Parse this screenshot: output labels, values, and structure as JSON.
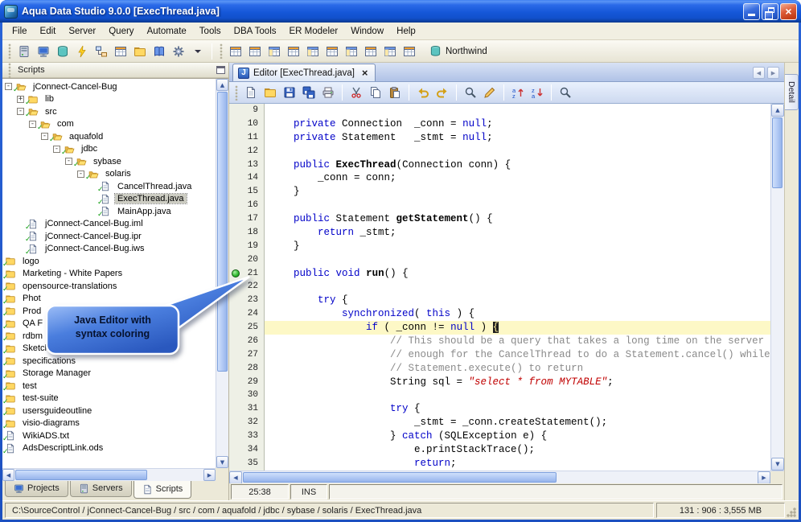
{
  "window": {
    "title": "Aqua Data Studio 9.0.0 [ExecThread.java]",
    "controls": {
      "close": "×"
    }
  },
  "glyphs": {
    "up": "▲",
    "down": "▼",
    "left": "◀",
    "right": "▶"
  },
  "menubar": {
    "items": [
      "File",
      "Edit",
      "Server",
      "Query",
      "Automate",
      "Tools",
      "DBA Tools",
      "ER Modeler",
      "Window",
      "Help"
    ]
  },
  "main_toolbar": {
    "icons": [
      {
        "name": "register-server-icon",
        "sym": "server"
      },
      {
        "name": "server-browser-icon",
        "sym": "monitor"
      },
      {
        "name": "schema-browser-icon",
        "sym": "db"
      },
      {
        "name": "query-analyzer-icon",
        "sym": "bolt"
      },
      {
        "name": "er-modeler-icon",
        "sym": "er"
      },
      {
        "name": "table-data-icon",
        "sym": "grid"
      },
      {
        "name": "open-file-icon",
        "sym": "folder"
      },
      {
        "name": "reference-book-icon",
        "sym": "book"
      },
      {
        "name": "options-icon",
        "sym": "gear"
      },
      {
        "name": "toolbar-menu-caret-icon",
        "sym": "caret"
      }
    ],
    "grid_icons": [
      {
        "name": "result-grid-icon-1",
        "sym": "grid"
      },
      {
        "name": "result-grid-icon-2",
        "sym": "grid"
      },
      {
        "name": "result-grid-icon-3",
        "sym": "grid2"
      },
      {
        "name": "result-grid-icon-4",
        "sym": "grid"
      },
      {
        "name": "result-grid-icon-5",
        "sym": "grid2"
      },
      {
        "name": "result-grid-icon-6",
        "sym": "grid"
      },
      {
        "name": "result-grid-icon-7",
        "sym": "grid2"
      },
      {
        "name": "result-grid-icon-8",
        "sym": "grid"
      },
      {
        "name": "result-grid-icon-9",
        "sym": "grid2"
      },
      {
        "name": "result-grid-icon-10",
        "sym": "grid"
      }
    ],
    "connection": {
      "name": "current-connection",
      "label": "Northwind",
      "sym": "db"
    }
  },
  "scripts_panel": {
    "title": "Scripts",
    "check_glyph": "✓",
    "tree": [
      {
        "i": 0,
        "e": "-",
        "t": "folder-open",
        "l": "jConnect-Cancel-Bug"
      },
      {
        "i": 1,
        "e": "+",
        "t": "folder",
        "l": "lib"
      },
      {
        "i": 1,
        "e": "-",
        "t": "folder-open",
        "l": "src"
      },
      {
        "i": 2,
        "e": "-",
        "t": "folder-open",
        "l": "com"
      },
      {
        "i": 3,
        "e": "-",
        "t": "folder-open",
        "l": "aquafold"
      },
      {
        "i": 4,
        "e": "-",
        "t": "folder-open",
        "l": "jdbc"
      },
      {
        "i": 5,
        "e": "-",
        "t": "folder-open",
        "l": "sybase"
      },
      {
        "i": 6,
        "e": "-",
        "t": "folder-open",
        "l": "solaris"
      },
      {
        "i": 7,
        "e": "",
        "t": "file",
        "l": "CancelThread.java"
      },
      {
        "i": 7,
        "e": "",
        "t": "file",
        "l": "ExecThread.java",
        "sel": true
      },
      {
        "i": 7,
        "e": "",
        "t": "file",
        "l": "MainApp.java"
      },
      {
        "i": 1,
        "e": "",
        "t": "file",
        "l": "jConnect-Cancel-Bug.iml"
      },
      {
        "i": 1,
        "e": "",
        "t": "file",
        "l": "jConnect-Cancel-Bug.ipr"
      },
      {
        "i": 1,
        "e": "",
        "t": "file",
        "l": "jConnect-Cancel-Bug.iws"
      },
      {
        "i": 0,
        "e": "",
        "t": "folder",
        "l": "logo"
      },
      {
        "i": 0,
        "e": "",
        "t": "folder",
        "l": "Marketing - White Papers"
      },
      {
        "i": 0,
        "e": "",
        "t": "folder",
        "l": "opensource-translations"
      },
      {
        "i": 0,
        "e": "",
        "t": "folder",
        "l": "Phot"
      },
      {
        "i": 0,
        "e": "",
        "t": "folder",
        "l": "Prod"
      },
      {
        "i": 0,
        "e": "",
        "t": "folder",
        "l": "QA F"
      },
      {
        "i": 0,
        "e": "",
        "t": "folder",
        "l": "rdbm"
      },
      {
        "i": 0,
        "e": "",
        "t": "folder",
        "l": "Sketchbooks"
      },
      {
        "i": 0,
        "e": "",
        "t": "folder",
        "l": "specifications"
      },
      {
        "i": 0,
        "e": "",
        "t": "folder",
        "l": "Storage Manager"
      },
      {
        "i": 0,
        "e": "",
        "t": "folder",
        "l": "test"
      },
      {
        "i": 0,
        "e": "",
        "t": "folder",
        "l": "test-suite"
      },
      {
        "i": 0,
        "e": "",
        "t": "folder",
        "l": "usersguideoutline"
      },
      {
        "i": 0,
        "e": "",
        "t": "folder",
        "l": "visio-diagrams"
      },
      {
        "i": 0,
        "e": "",
        "t": "file",
        "l": "WikiADS.txt"
      },
      {
        "i": 0,
        "e": "",
        "t": "file",
        "l": "AdsDescriptLink.ods"
      }
    ],
    "tabs": [
      {
        "name": "tab-projects",
        "label": "Projects",
        "sym": "monitor"
      },
      {
        "name": "tab-servers",
        "label": "Servers",
        "sym": "server"
      },
      {
        "name": "tab-scripts",
        "label": "Scripts",
        "sym": "page",
        "active": true
      }
    ]
  },
  "callout": {
    "line1": "Java Editor with",
    "line2": "syntax coloring"
  },
  "right_panel": {
    "tab": "Detail"
  },
  "editor": {
    "tab": {
      "label": "Editor [ExecThread.java]",
      "close": "×",
      "icon_glyph": "J"
    },
    "toolbar_icons": [
      {
        "name": "new-file-icon",
        "sym": "page"
      },
      {
        "name": "open-file-icon",
        "sym": "folder"
      },
      {
        "name": "save-icon",
        "sym": "floppy"
      },
      {
        "name": "save-all-icon",
        "sym": "floppy2"
      },
      {
        "name": "print-icon",
        "sym": "printer"
      },
      {
        "sep": true
      },
      {
        "name": "cut-icon",
        "sym": "scissors"
      },
      {
        "name": "copy-icon",
        "sym": "copy"
      },
      {
        "name": "paste-icon",
        "sym": "paste"
      },
      {
        "sep": true
      },
      {
        "name": "undo-icon",
        "sym": "undo"
      },
      {
        "name": "redo-icon",
        "sym": "redo"
      },
      {
        "sep": true
      },
      {
        "name": "find-icon",
        "sym": "find"
      },
      {
        "name": "replace-icon",
        "sym": "pencil"
      },
      {
        "sep": true
      },
      {
        "name": "sort-ascending-icon",
        "sym": "sortasc"
      },
      {
        "name": "sort-descending-icon",
        "sym": "sortdesc"
      },
      {
        "sep": true
      },
      {
        "name": "zoom-icon",
        "sym": "find"
      }
    ],
    "code": {
      "lines": [
        {
          "n": 9,
          "seg": []
        },
        {
          "n": 10,
          "seg": [
            [
              "p",
              "    "
            ],
            [
              "k",
              "private"
            ],
            [
              "p",
              " Connection  _conn = "
            ],
            [
              "k",
              "null"
            ],
            [
              "p",
              ";"
            ]
          ]
        },
        {
          "n": 11,
          "seg": [
            [
              "p",
              "    "
            ],
            [
              "k",
              "private"
            ],
            [
              "p",
              " Statement   _stmt = "
            ],
            [
              "k",
              "null"
            ],
            [
              "p",
              ";"
            ]
          ]
        },
        {
          "n": 12,
          "seg": []
        },
        {
          "n": 13,
          "seg": [
            [
              "p",
              "    "
            ],
            [
              "k",
              "public"
            ],
            [
              "p",
              " "
            ],
            [
              "m",
              "ExecThread"
            ],
            [
              "p",
              "(Connection conn) {"
            ]
          ]
        },
        {
          "n": 14,
          "seg": [
            [
              "p",
              "        _conn = conn;"
            ]
          ]
        },
        {
          "n": 15,
          "seg": [
            [
              "p",
              "    }"
            ]
          ]
        },
        {
          "n": 16,
          "seg": []
        },
        {
          "n": 17,
          "seg": [
            [
              "p",
              "    "
            ],
            [
              "k",
              "public"
            ],
            [
              "p",
              " Statement "
            ],
            [
              "m",
              "getStatement"
            ],
            [
              "p",
              "() {"
            ]
          ]
        },
        {
          "n": 18,
          "seg": [
            [
              "p",
              "        "
            ],
            [
              "k",
              "return"
            ],
            [
              "p",
              " _stmt;"
            ]
          ]
        },
        {
          "n": 19,
          "seg": [
            [
              "p",
              "    }"
            ]
          ]
        },
        {
          "n": 20,
          "seg": []
        },
        {
          "n": 21,
          "mk": true,
          "seg": [
            [
              "p",
              "    "
            ],
            [
              "k",
              "public"
            ],
            [
              "p",
              " "
            ],
            [
              "k",
              "void"
            ],
            [
              "p",
              " "
            ],
            [
              "m",
              "run"
            ],
            [
              "p",
              "() {"
            ]
          ]
        },
        {
          "n": 22,
          "seg": []
        },
        {
          "n": 23,
          "seg": [
            [
              "p",
              "        "
            ],
            [
              "k",
              "try"
            ],
            [
              "p",
              " {"
            ]
          ]
        },
        {
          "n": 24,
          "seg": [
            [
              "p",
              "            "
            ],
            [
              "k",
              "synchronized"
            ],
            [
              "p",
              "( "
            ],
            [
              "k",
              "this"
            ],
            [
              "p",
              " ) {"
            ]
          ]
        },
        {
          "n": 25,
          "hl": true,
          "seg": [
            [
              "p",
              "                "
            ],
            [
              "k",
              "if"
            ],
            [
              "p",
              " ( _conn != "
            ],
            [
              "k",
              "null"
            ],
            [
              "p",
              " ) "
            ],
            [
              "b",
              "{"
            ]
          ]
        },
        {
          "n": 26,
          "seg": [
            [
              "p",
              "                    "
            ],
            [
              "c",
              "// This should be a query that takes a long time on the server so"
            ]
          ]
        },
        {
          "n": 27,
          "seg": [
            [
              "p",
              "                    "
            ],
            [
              "c",
              "// enough for the CancelThread to do a Statement.cancel() while t"
            ]
          ]
        },
        {
          "n": 28,
          "seg": [
            [
              "p",
              "                    "
            ],
            [
              "c",
              "// Statement.execute() to return"
            ]
          ]
        },
        {
          "n": 29,
          "seg": [
            [
              "p",
              "                    String sql = "
            ],
            [
              "s",
              "\"select * from MYTABLE\""
            ],
            [
              "p",
              ";"
            ]
          ]
        },
        {
          "n": 30,
          "seg": []
        },
        {
          "n": 31,
          "seg": [
            [
              "p",
              "                    "
            ],
            [
              "k",
              "try"
            ],
            [
              "p",
              " {"
            ]
          ]
        },
        {
          "n": 32,
          "seg": [
            [
              "p",
              "                        _stmt = _conn.createStatement();"
            ]
          ]
        },
        {
          "n": 33,
          "seg": [
            [
              "p",
              "                    } "
            ],
            [
              "k",
              "catch"
            ],
            [
              "p",
              " (SQLException e) {"
            ]
          ]
        },
        {
          "n": 34,
          "seg": [
            [
              "p",
              "                        e.printStackTrace();"
            ]
          ]
        },
        {
          "n": 35,
          "seg": [
            [
              "p",
              "                        "
            ],
            [
              "k",
              "return"
            ],
            [
              "p",
              ";"
            ]
          ]
        }
      ]
    },
    "status": {
      "position": "25:38",
      "mode": "INS"
    }
  },
  "statusbar": {
    "path": "C:\\SourceControl / jConnect-Cancel-Bug / src / com / aquafold / jdbc / sybase / solaris / ExecThread.java",
    "memory": "131 : 906 : 3,555 MB"
  },
  "colors": {
    "titlebar_blue": "#1557d8",
    "keyword": "#0000c8",
    "string": "#c00000",
    "comment": "#8a8a8a",
    "line_highlight": "#fdf8c6",
    "callout_blue": "#4a7ede",
    "bookmark_green": "#2eb82e"
  }
}
